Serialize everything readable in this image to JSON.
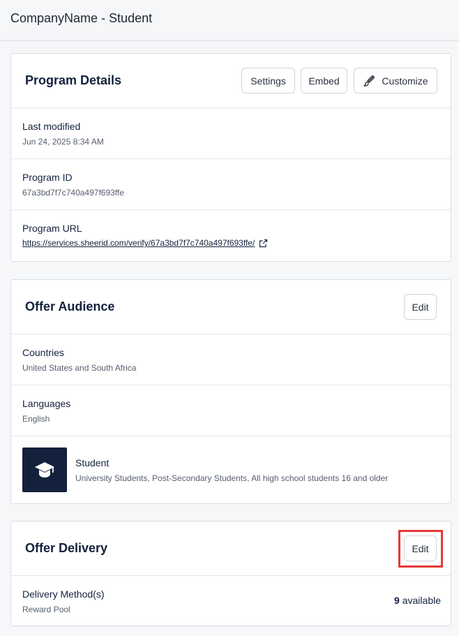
{
  "header": {
    "title": "CompanyName - Student"
  },
  "program_details": {
    "title": "Program Details",
    "buttons": {
      "settings": "Settings",
      "embed": "Embed",
      "customize": "Customize"
    },
    "last_modified": {
      "label": "Last modified",
      "value": "Jun 24, 2025 8:34 AM"
    },
    "program_id": {
      "label": "Program ID",
      "value": "67a3bd7f7c740a497f693ffe"
    },
    "program_url": {
      "label": "Program URL",
      "value": "https://services.sheerid.com/verify/67a3bd7f7c740a497f693ffe/"
    }
  },
  "offer_audience": {
    "title": "Offer Audience",
    "edit_label": "Edit",
    "countries": {
      "label": "Countries",
      "value": "United States and South Africa"
    },
    "languages": {
      "label": "Languages",
      "value": "English"
    },
    "segment": {
      "name": "Student",
      "description": "University Students, Post-Secondary Students, All high school students 16 and older",
      "icon": "graduation-cap-icon"
    }
  },
  "offer_delivery": {
    "title": "Offer Delivery",
    "edit_label": "Edit",
    "delivery_method": {
      "label": "Delivery Method(s)",
      "value": "Reward Pool",
      "available_count": "9",
      "available_label": "available"
    }
  },
  "colors": {
    "highlight": "#e53935",
    "segment_tile": "#14213d"
  }
}
